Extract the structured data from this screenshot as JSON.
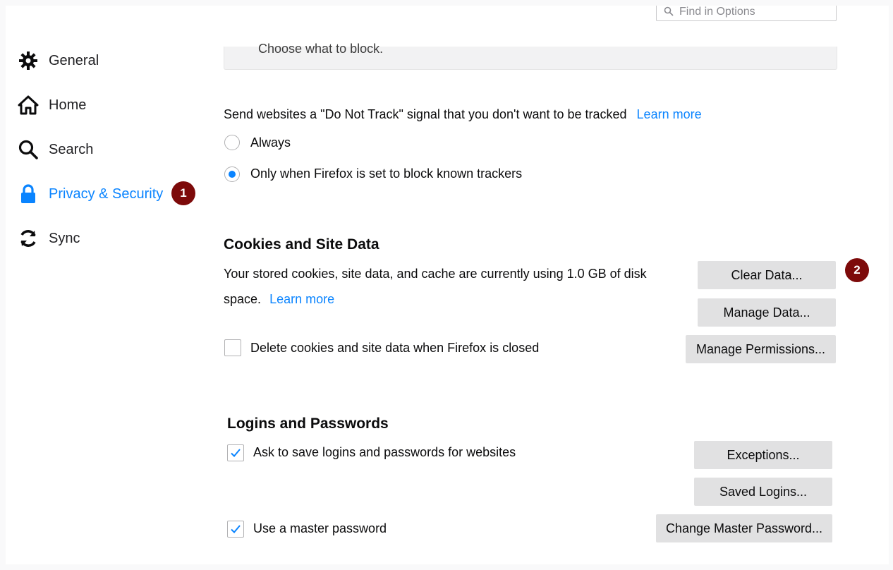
{
  "search": {
    "placeholder": "Find in Options"
  },
  "top_box": {
    "text": "Choose what to block."
  },
  "sidebar": {
    "items": [
      {
        "label": "General",
        "icon": "gear-icon"
      },
      {
        "label": "Home",
        "icon": "home-icon"
      },
      {
        "label": "Search",
        "icon": "search-icon"
      },
      {
        "label": "Privacy & Security",
        "icon": "lock-icon",
        "selected": true
      },
      {
        "label": "Sync",
        "icon": "sync-icon"
      }
    ]
  },
  "badges": {
    "one": "1",
    "two": "2"
  },
  "dnt": {
    "text": "Send websites a \"Do Not Track\" signal that you don't want to be tracked",
    "learn_more": "Learn more",
    "options": [
      {
        "label": "Always",
        "checked": false
      },
      {
        "label": "Only when Firefox is set to block known trackers",
        "checked": true
      }
    ]
  },
  "cookies": {
    "heading": "Cookies and Site Data",
    "desc_line1": "Your stored cookies, site data, and cache are currently using 1.0 GB of disk",
    "desc_line2": "space.",
    "learn_more": "Learn more",
    "clear_data": "Clear Data...",
    "manage_data": "Manage Data...",
    "manage_permissions": "Manage Permissions...",
    "delete_on_close": {
      "label": "Delete cookies and site data when Firefox is closed",
      "checked": false
    }
  },
  "logins": {
    "heading": "Logins and Passwords",
    "ask_save": {
      "label": "Ask to save logins and passwords for websites",
      "checked": true
    },
    "exceptions": "Exceptions...",
    "saved_logins": "Saved Logins...",
    "master_password": {
      "label": "Use a master password",
      "checked": true
    },
    "change_master": "Change Master Password..."
  },
  "colors": {
    "accent": "#0a84ff",
    "badge": "#7d0a0a",
    "button_bg": "#e1e1e2"
  }
}
